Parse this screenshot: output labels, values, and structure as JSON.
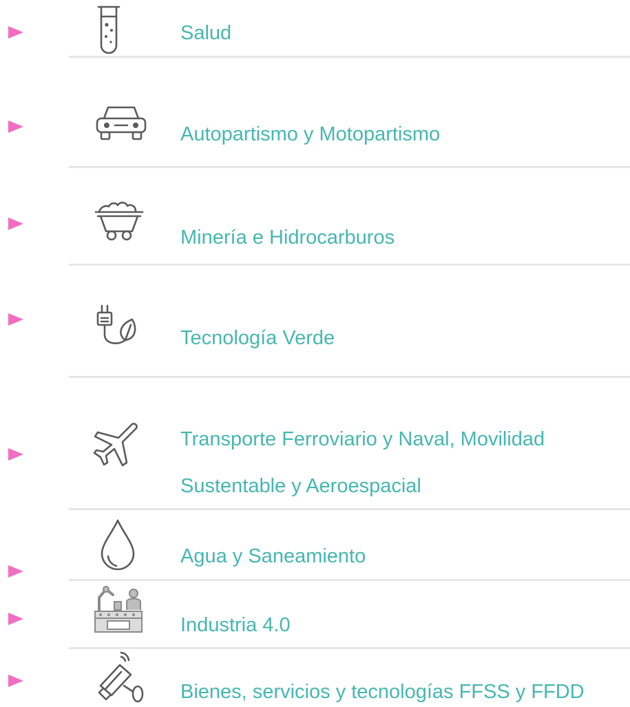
{
  "categories": [
    {
      "label": "Salud",
      "icon": "test-tube-icon"
    },
    {
      "label": "Autopartismo y Motopartismo",
      "icon": "car-icon"
    },
    {
      "label": "Minería e Hidrocarburos",
      "icon": "mine-cart-icon"
    },
    {
      "label": "Tecnología Verde",
      "icon": "green-plug-icon"
    },
    {
      "label": "Transporte Ferroviario y Naval, Movilidad Sustentable y Aeroespacial",
      "label_line1": "Transporte Ferroviario y Naval, Movilidad",
      "label_line2": "Sustentable y Aeroespacial",
      "icon": "airplane-icon"
    },
    {
      "label": "Agua y Saneamiento",
      "icon": "water-drop-icon"
    },
    {
      "label": "Industria 4.0",
      "icon": "factory-robot-icon"
    },
    {
      "label": "Bienes, servicios y tecnologías FFSS y FFDD",
      "icon": "security-camera-icon"
    }
  ],
  "colors": {
    "label": "#45b7b0",
    "arrow": "#f26ec2",
    "icon": "#5b5b5b",
    "divider": "#e6e6e6"
  }
}
